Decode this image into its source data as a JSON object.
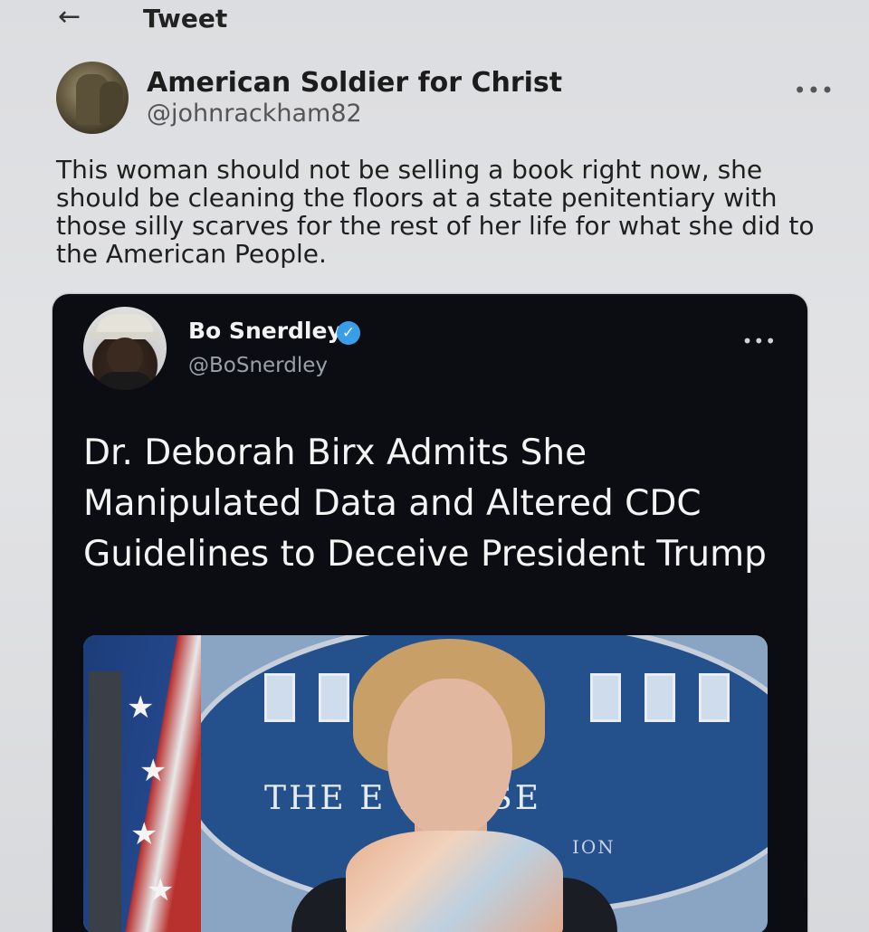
{
  "header": {
    "back_icon": "←",
    "title": "Tweet"
  },
  "author": {
    "name": "American Soldier for Christ",
    "handle": "@johnrackham82",
    "more_icon": "•••"
  },
  "tweet": {
    "text": "This woman should not be selling a book right now, she should be cleaning the floors at a state penitentiary with those silly scarves for the rest of her life for what she did to the American People."
  },
  "quote": {
    "name": "Bo Snerdley",
    "verified_icon": "✓",
    "handle": "@BoSnerdley",
    "more_icon": "•••",
    "headline": "Dr. Deborah Birx Admits She Manipulated Data and Altered CDC Guidelines to Deceive President Trump",
    "image": {
      "seal_text": "THE      E HOUSE",
      "seal_sub": "ION"
    }
  },
  "colors": {
    "page_bg": "#dcdde0",
    "card_bg": "#0c0d12",
    "verified": "#3a9de8",
    "seal_blue": "#24508c"
  }
}
